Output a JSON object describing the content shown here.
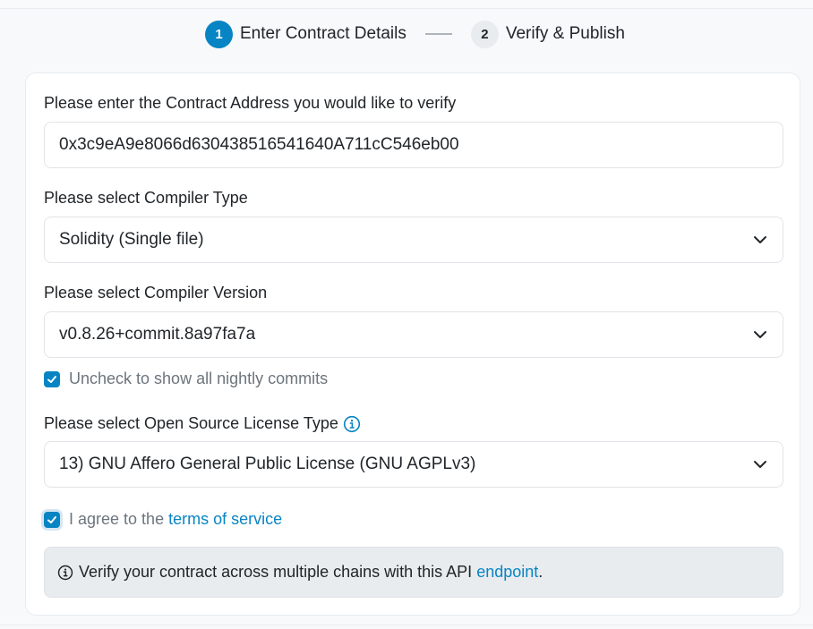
{
  "stepper": {
    "steps": [
      {
        "number": "1",
        "label": "Enter Contract Details",
        "state": "active"
      },
      {
        "number": "2",
        "label": "Verify & Publish",
        "state": "inactive"
      }
    ]
  },
  "form": {
    "address_label": "Please enter the Contract Address you would like to verify",
    "address_value": "0x3c9eA9e8066d630438516541640A711cC546eb00",
    "compiler_type_label": "Please select Compiler Type",
    "compiler_type_value": "Solidity (Single file)",
    "compiler_version_label": "Please select Compiler Version",
    "compiler_version_value": "v0.8.26+commit.8a97fa7a",
    "nightly_label": "Uncheck to show all nightly commits",
    "nightly_checked": true,
    "license_label": "Please select Open Source License Type",
    "license_value": "13) GNU Affero General Public License (GNU AGPLv3)",
    "terms_prefix": "I agree to the",
    "terms_link": "terms of service",
    "terms_checked": true
  },
  "alert": {
    "text": "Verify your contract across multiple chains with this API",
    "link": "endpoint",
    "suffix": "."
  },
  "colors": {
    "accent": "#0784c3",
    "step_inactive_bg": "#e9ecef",
    "alert_bg": "#e9ecef"
  },
  "icons": {
    "dropdown": "chevron-down-icon",
    "check": "check-icon",
    "info": "info-circle-icon"
  }
}
